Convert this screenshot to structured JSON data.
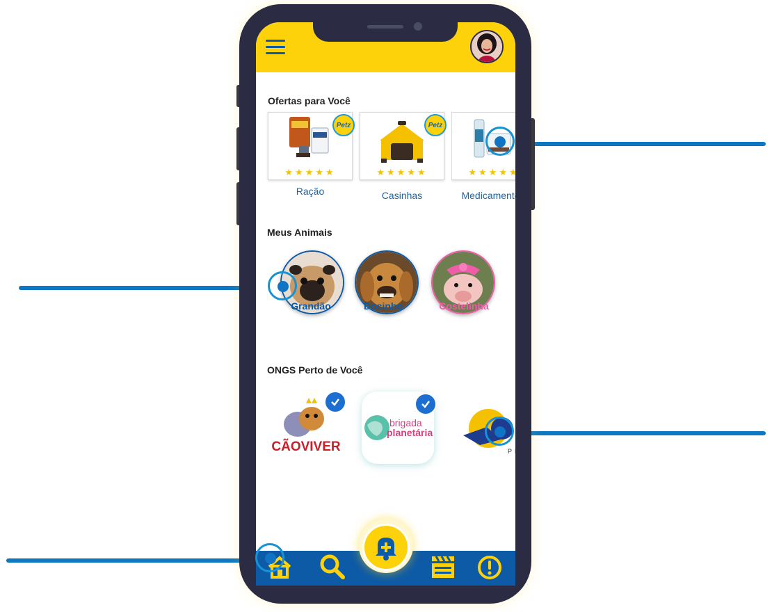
{
  "header": {
    "menu_icon": "hamburger-menu-icon",
    "avatar_icon": "user-avatar-icon"
  },
  "offers": {
    "title": "Ofertas para Você",
    "items": [
      {
        "label": "Ração",
        "rating": "★★★★★",
        "badge": "Petz"
      },
      {
        "label": "Casinhas",
        "rating": "★★★★★",
        "badge": "Petz"
      },
      {
        "label": "Medicamentos",
        "rating": "★★★★★",
        "badge": ""
      }
    ]
  },
  "animals": {
    "title": "Meus Animais",
    "items": [
      {
        "name": "Grandão",
        "color": "#0d5aa7"
      },
      {
        "name": "Docinho",
        "color": "#0d5aa7"
      },
      {
        "name": "Costelinha",
        "color": "#ef5ca8"
      }
    ]
  },
  "ongs": {
    "title": "ONGS Perto de Você",
    "items": [
      {
        "name": "CÃOVIVER",
        "verified": true
      },
      {
        "name_line1": "brigada",
        "name_line2": "planetária",
        "verified": true
      },
      {
        "name": "PR",
        "verified": false
      }
    ]
  },
  "bottom_nav": {
    "items": [
      "home-icon",
      "search-icon",
      "alert-bell-plus-icon",
      "clapperboard-icon",
      "exclamation-icon"
    ]
  },
  "colors": {
    "primary_yellow": "#fdd20a",
    "primary_blue": "#0d5aa7",
    "phone_frame": "#2b2c44",
    "pink": "#ef5ca8"
  }
}
